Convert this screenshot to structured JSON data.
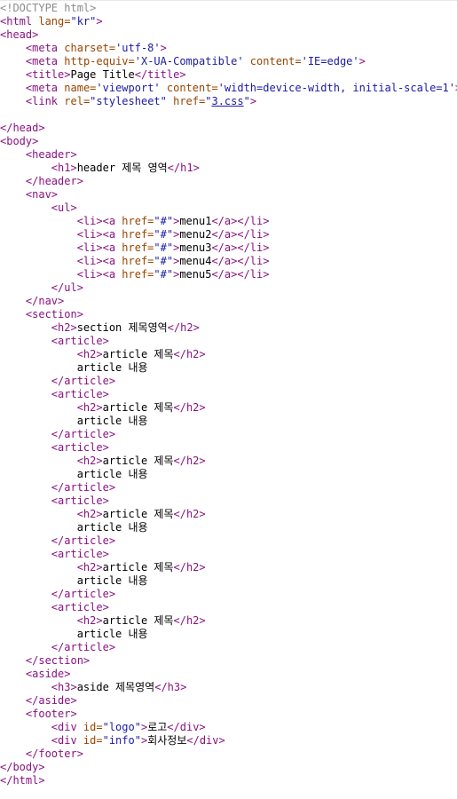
{
  "source_lines": [
    [
      {
        "t": "c",
        "s": "<!DOCTYPE html>"
      }
    ],
    [
      {
        "t": "t",
        "s": "<html "
      },
      {
        "t": "a",
        "s": "lang="
      },
      {
        "t": "v",
        "s": "\"kr\""
      },
      {
        "t": "t",
        "s": ">"
      }
    ],
    [
      {
        "t": "t",
        "s": "<head>"
      }
    ],
    [
      {
        "t": "txt",
        "s": "    "
      },
      {
        "t": "t",
        "s": "<meta "
      },
      {
        "t": "a",
        "s": "charset="
      },
      {
        "t": "v",
        "s": "'utf-8'"
      },
      {
        "t": "t",
        "s": ">"
      }
    ],
    [
      {
        "t": "txt",
        "s": "    "
      },
      {
        "t": "t",
        "s": "<meta "
      },
      {
        "t": "a",
        "s": "http-equiv="
      },
      {
        "t": "v",
        "s": "'X-UA-Compatible'"
      },
      {
        "t": "a",
        "s": " content="
      },
      {
        "t": "v",
        "s": "'IE=edge'"
      },
      {
        "t": "t",
        "s": ">"
      }
    ],
    [
      {
        "t": "txt",
        "s": "    "
      },
      {
        "t": "t",
        "s": "<title>"
      },
      {
        "t": "txt",
        "s": "Page Title"
      },
      {
        "t": "t",
        "s": "</title>"
      }
    ],
    [
      {
        "t": "txt",
        "s": "    "
      },
      {
        "t": "t",
        "s": "<meta "
      },
      {
        "t": "a",
        "s": "name="
      },
      {
        "t": "v",
        "s": "'viewport'"
      },
      {
        "t": "a",
        "s": " content="
      },
      {
        "t": "v",
        "s": "'width=device-width, initial-scale=1'"
      },
      {
        "t": "t",
        "s": ">"
      }
    ],
    [
      {
        "t": "txt",
        "s": "    "
      },
      {
        "t": "t",
        "s": "<link "
      },
      {
        "t": "a",
        "s": "rel="
      },
      {
        "t": "v",
        "s": "\"stylesheet\""
      },
      {
        "t": "a",
        "s": " href="
      },
      {
        "t": "v",
        "s": "\""
      },
      {
        "t": "lk",
        "s": "3.css"
      },
      {
        "t": "v",
        "s": "\""
      },
      {
        "t": "t",
        "s": ">"
      }
    ],
    [],
    [
      {
        "t": "t",
        "s": "</head>"
      }
    ],
    [
      {
        "t": "t",
        "s": "<body>"
      }
    ],
    [
      {
        "t": "txt",
        "s": "    "
      },
      {
        "t": "t",
        "s": "<header>"
      }
    ],
    [
      {
        "t": "txt",
        "s": "        "
      },
      {
        "t": "t",
        "s": "<h1>"
      },
      {
        "t": "txt",
        "s": "header 제목 영역"
      },
      {
        "t": "t",
        "s": "</h1>"
      }
    ],
    [
      {
        "t": "txt",
        "s": "    "
      },
      {
        "t": "t",
        "s": "</header>"
      }
    ],
    [
      {
        "t": "txt",
        "s": "    "
      },
      {
        "t": "t",
        "s": "<nav>"
      }
    ],
    [
      {
        "t": "txt",
        "s": "        "
      },
      {
        "t": "t",
        "s": "<ul>"
      }
    ],
    [
      {
        "t": "txt",
        "s": "            "
      },
      {
        "t": "t",
        "s": "<li><a "
      },
      {
        "t": "a",
        "s": "href="
      },
      {
        "t": "v",
        "s": "\"#\""
      },
      {
        "t": "t",
        "s": ">"
      },
      {
        "t": "txt",
        "s": "menu1"
      },
      {
        "t": "t",
        "s": "</a></li>"
      }
    ],
    [
      {
        "t": "txt",
        "s": "            "
      },
      {
        "t": "t",
        "s": "<li><a "
      },
      {
        "t": "a",
        "s": "href="
      },
      {
        "t": "v",
        "s": "\"#\""
      },
      {
        "t": "t",
        "s": ">"
      },
      {
        "t": "txt",
        "s": "menu2"
      },
      {
        "t": "t",
        "s": "</a></li>"
      }
    ],
    [
      {
        "t": "txt",
        "s": "            "
      },
      {
        "t": "t",
        "s": "<li><a "
      },
      {
        "t": "a",
        "s": "href="
      },
      {
        "t": "v",
        "s": "\"#\""
      },
      {
        "t": "t",
        "s": ">"
      },
      {
        "t": "txt",
        "s": "menu3"
      },
      {
        "t": "t",
        "s": "</a></li>"
      }
    ],
    [
      {
        "t": "txt",
        "s": "            "
      },
      {
        "t": "t",
        "s": "<li><a "
      },
      {
        "t": "a",
        "s": "href="
      },
      {
        "t": "v",
        "s": "\"#\""
      },
      {
        "t": "t",
        "s": ">"
      },
      {
        "t": "txt",
        "s": "menu4"
      },
      {
        "t": "t",
        "s": "</a></li>"
      }
    ],
    [
      {
        "t": "txt",
        "s": "            "
      },
      {
        "t": "t",
        "s": "<li><a "
      },
      {
        "t": "a",
        "s": "href="
      },
      {
        "t": "v",
        "s": "\"#\""
      },
      {
        "t": "t",
        "s": ">"
      },
      {
        "t": "txt",
        "s": "menu5"
      },
      {
        "t": "t",
        "s": "</a></li>"
      }
    ],
    [
      {
        "t": "txt",
        "s": "        "
      },
      {
        "t": "t",
        "s": "</ul>"
      }
    ],
    [
      {
        "t": "txt",
        "s": "    "
      },
      {
        "t": "t",
        "s": "</nav>"
      }
    ],
    [
      {
        "t": "txt",
        "s": "    "
      },
      {
        "t": "t",
        "s": "<section>"
      }
    ],
    [
      {
        "t": "txt",
        "s": "        "
      },
      {
        "t": "t",
        "s": "<h2>"
      },
      {
        "t": "txt",
        "s": "section 제목영역"
      },
      {
        "t": "t",
        "s": "</h2>"
      }
    ],
    [
      {
        "t": "txt",
        "s": "        "
      },
      {
        "t": "t",
        "s": "<article>"
      }
    ],
    [
      {
        "t": "txt",
        "s": "            "
      },
      {
        "t": "t",
        "s": "<h2>"
      },
      {
        "t": "txt",
        "s": "article 제목"
      },
      {
        "t": "t",
        "s": "</h2>"
      }
    ],
    [
      {
        "t": "txt",
        "s": "            article 내용"
      }
    ],
    [
      {
        "t": "txt",
        "s": "        "
      },
      {
        "t": "t",
        "s": "</article>"
      }
    ],
    [
      {
        "t": "txt",
        "s": "        "
      },
      {
        "t": "t",
        "s": "<article>"
      }
    ],
    [
      {
        "t": "txt",
        "s": "            "
      },
      {
        "t": "t",
        "s": "<h2>"
      },
      {
        "t": "txt",
        "s": "article 제목"
      },
      {
        "t": "t",
        "s": "</h2>"
      }
    ],
    [
      {
        "t": "txt",
        "s": "            article 내용"
      }
    ],
    [
      {
        "t": "txt",
        "s": "        "
      },
      {
        "t": "t",
        "s": "</article>"
      }
    ],
    [
      {
        "t": "txt",
        "s": "        "
      },
      {
        "t": "t",
        "s": "<article>"
      }
    ],
    [
      {
        "t": "txt",
        "s": "            "
      },
      {
        "t": "t",
        "s": "<h2>"
      },
      {
        "t": "txt",
        "s": "article 제목"
      },
      {
        "t": "t",
        "s": "</h2>"
      }
    ],
    [
      {
        "t": "txt",
        "s": "            article 내용"
      }
    ],
    [
      {
        "t": "txt",
        "s": "        "
      },
      {
        "t": "t",
        "s": "</article>"
      }
    ],
    [
      {
        "t": "txt",
        "s": "        "
      },
      {
        "t": "t",
        "s": "<article>"
      }
    ],
    [
      {
        "t": "txt",
        "s": "            "
      },
      {
        "t": "t",
        "s": "<h2>"
      },
      {
        "t": "txt",
        "s": "article 제목"
      },
      {
        "t": "t",
        "s": "</h2>"
      }
    ],
    [
      {
        "t": "txt",
        "s": "            article 내용"
      }
    ],
    [
      {
        "t": "txt",
        "s": "        "
      },
      {
        "t": "t",
        "s": "</article>"
      }
    ],
    [
      {
        "t": "txt",
        "s": "        "
      },
      {
        "t": "t",
        "s": "<article>"
      }
    ],
    [
      {
        "t": "txt",
        "s": "            "
      },
      {
        "t": "t",
        "s": "<h2>"
      },
      {
        "t": "txt",
        "s": "article 제목"
      },
      {
        "t": "t",
        "s": "</h2>"
      }
    ],
    [
      {
        "t": "txt",
        "s": "            article 내용"
      }
    ],
    [
      {
        "t": "txt",
        "s": "        "
      },
      {
        "t": "t",
        "s": "</article>"
      }
    ],
    [
      {
        "t": "txt",
        "s": "        "
      },
      {
        "t": "t",
        "s": "<article>"
      }
    ],
    [
      {
        "t": "txt",
        "s": "            "
      },
      {
        "t": "t",
        "s": "<h2>"
      },
      {
        "t": "txt",
        "s": "article 제목"
      },
      {
        "t": "t",
        "s": "</h2>"
      }
    ],
    [
      {
        "t": "txt",
        "s": "            article 내용"
      }
    ],
    [
      {
        "t": "txt",
        "s": "        "
      },
      {
        "t": "t",
        "s": "</article>"
      }
    ],
    [
      {
        "t": "txt",
        "s": "    "
      },
      {
        "t": "t",
        "s": "</section>"
      }
    ],
    [
      {
        "t": "txt",
        "s": "    "
      },
      {
        "t": "t",
        "s": "<aside>"
      }
    ],
    [
      {
        "t": "txt",
        "s": "        "
      },
      {
        "t": "t",
        "s": "<h3>"
      },
      {
        "t": "txt",
        "s": "aside 제목영역"
      },
      {
        "t": "t",
        "s": "</h3>"
      }
    ],
    [
      {
        "t": "txt",
        "s": "    "
      },
      {
        "t": "t",
        "s": "</aside>"
      }
    ],
    [
      {
        "t": "txt",
        "s": "    "
      },
      {
        "t": "t",
        "s": "<footer>"
      }
    ],
    [
      {
        "t": "txt",
        "s": "        "
      },
      {
        "t": "t",
        "s": "<div "
      },
      {
        "t": "a",
        "s": "id="
      },
      {
        "t": "v",
        "s": "\"logo\""
      },
      {
        "t": "t",
        "s": ">"
      },
      {
        "t": "txt",
        "s": "로고"
      },
      {
        "t": "t",
        "s": "</div>"
      }
    ],
    [
      {
        "t": "txt",
        "s": "        "
      },
      {
        "t": "t",
        "s": "<div "
      },
      {
        "t": "a",
        "s": "id="
      },
      {
        "t": "v",
        "s": "\"info\""
      },
      {
        "t": "t",
        "s": ">"
      },
      {
        "t": "txt",
        "s": "회사정보"
      },
      {
        "t": "t",
        "s": "</div>"
      }
    ],
    [
      {
        "t": "txt",
        "s": "    "
      },
      {
        "t": "t",
        "s": "</footer>"
      }
    ],
    [
      {
        "t": "t",
        "s": "</body>"
      }
    ],
    [
      {
        "t": "t",
        "s": "</html>"
      }
    ]
  ]
}
